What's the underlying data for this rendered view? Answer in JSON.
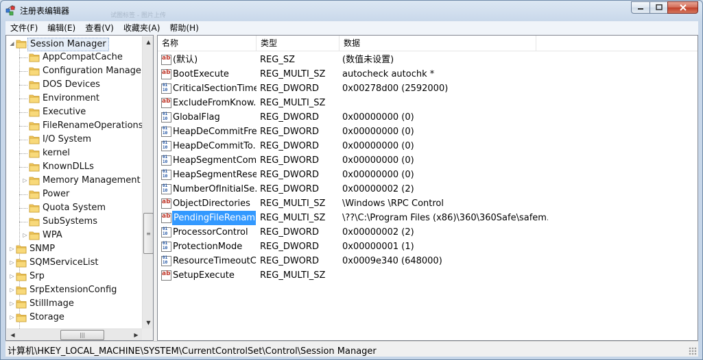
{
  "window": {
    "title": "注册表编辑器",
    "ghost_title": "试图标签 - 图片上传",
    "buttons": {
      "minimize": "minimize",
      "maximize": "maximize",
      "close": "close"
    }
  },
  "menu": [
    "文件(F)",
    "编辑(E)",
    "查看(V)",
    "收藏夹(A)",
    "帮助(H)"
  ],
  "tree": {
    "selected": "Session Manager",
    "items": [
      {
        "label": "Session Manager",
        "level": 1,
        "expander": "open",
        "selected": true
      },
      {
        "label": "AppCompatCache",
        "level": 2,
        "expander": "none"
      },
      {
        "label": "Configuration Manager",
        "level": 2,
        "expander": "none"
      },
      {
        "label": "DOS Devices",
        "level": 2,
        "expander": "none"
      },
      {
        "label": "Environment",
        "level": 2,
        "expander": "none"
      },
      {
        "label": "Executive",
        "level": 2,
        "expander": "none"
      },
      {
        "label": "FileRenameOperations",
        "level": 2,
        "expander": "none"
      },
      {
        "label": "I/O System",
        "level": 2,
        "expander": "none"
      },
      {
        "label": "kernel",
        "level": 2,
        "expander": "none"
      },
      {
        "label": "KnownDLLs",
        "level": 2,
        "expander": "none"
      },
      {
        "label": "Memory Management",
        "level": 2,
        "expander": "closed"
      },
      {
        "label": "Power",
        "level": 2,
        "expander": "none"
      },
      {
        "label": "Quota System",
        "level": 2,
        "expander": "none"
      },
      {
        "label": "SubSystems",
        "level": 2,
        "expander": "none"
      },
      {
        "label": "WPA",
        "level": 2,
        "expander": "closed"
      },
      {
        "label": "SNMP",
        "level": 1,
        "expander": "closed"
      },
      {
        "label": "SQMServiceList",
        "level": 1,
        "expander": "closed"
      },
      {
        "label": "Srp",
        "level": 1,
        "expander": "closed"
      },
      {
        "label": "SrpExtensionConfig",
        "level": 1,
        "expander": "closed"
      },
      {
        "label": "StillImage",
        "level": 1,
        "expander": "closed"
      },
      {
        "label": "Storage",
        "level": 1,
        "expander": "closed"
      }
    ]
  },
  "list": {
    "columns": {
      "name": "名称",
      "type": "类型",
      "data": "数据"
    },
    "rows": [
      {
        "icon": "string-value-icon",
        "name": "(默认)",
        "type": "REG_SZ",
        "data": "(数值未设置)"
      },
      {
        "icon": "string-value-icon",
        "name": "BootExecute",
        "type": "REG_MULTI_SZ",
        "data": "autocheck autochk *"
      },
      {
        "icon": "binary-value-icon",
        "name": "CriticalSectionTime...",
        "type": "REG_DWORD",
        "data": "0x00278d00 (2592000)"
      },
      {
        "icon": "string-value-icon",
        "name": "ExcludeFromKnow...",
        "type": "REG_MULTI_SZ",
        "data": ""
      },
      {
        "icon": "binary-value-icon",
        "name": "GlobalFlag",
        "type": "REG_DWORD",
        "data": "0x00000000 (0)"
      },
      {
        "icon": "binary-value-icon",
        "name": "HeapDeCommitFre...",
        "type": "REG_DWORD",
        "data": "0x00000000 (0)"
      },
      {
        "icon": "binary-value-icon",
        "name": "HeapDeCommitTo...",
        "type": "REG_DWORD",
        "data": "0x00000000 (0)"
      },
      {
        "icon": "binary-value-icon",
        "name": "HeapSegmentCom...",
        "type": "REG_DWORD",
        "data": "0x00000000 (0)"
      },
      {
        "icon": "binary-value-icon",
        "name": "HeapSegmentRese...",
        "type": "REG_DWORD",
        "data": "0x00000000 (0)"
      },
      {
        "icon": "binary-value-icon",
        "name": "NumberOfInitialSe...",
        "type": "REG_DWORD",
        "data": "0x00000002 (2)"
      },
      {
        "icon": "string-value-icon",
        "name": "ObjectDirectories",
        "type": "REG_MULTI_SZ",
        "data": "\\Windows \\RPC Control"
      },
      {
        "icon": "string-value-icon",
        "name": "PendingFileRenam...",
        "type": "REG_MULTI_SZ",
        "data": "\\??\\C:\\Program Files (x86)\\360\\360Safe\\safem...",
        "selected": true
      },
      {
        "icon": "binary-value-icon",
        "name": "ProcessorControl",
        "type": "REG_DWORD",
        "data": "0x00000002 (2)"
      },
      {
        "icon": "binary-value-icon",
        "name": "ProtectionMode",
        "type": "REG_DWORD",
        "data": "0x00000001 (1)"
      },
      {
        "icon": "binary-value-icon",
        "name": "ResourceTimeoutC...",
        "type": "REG_DWORD",
        "data": "0x0009e340 (648000)"
      },
      {
        "icon": "string-value-icon",
        "name": "SetupExecute",
        "type": "REG_MULTI_SZ",
        "data": ""
      }
    ]
  },
  "status": {
    "path": "计算机\\HKEY_LOCAL_MACHINE\\SYSTEM\\CurrentControlSet\\Control\\Session Manager"
  }
}
